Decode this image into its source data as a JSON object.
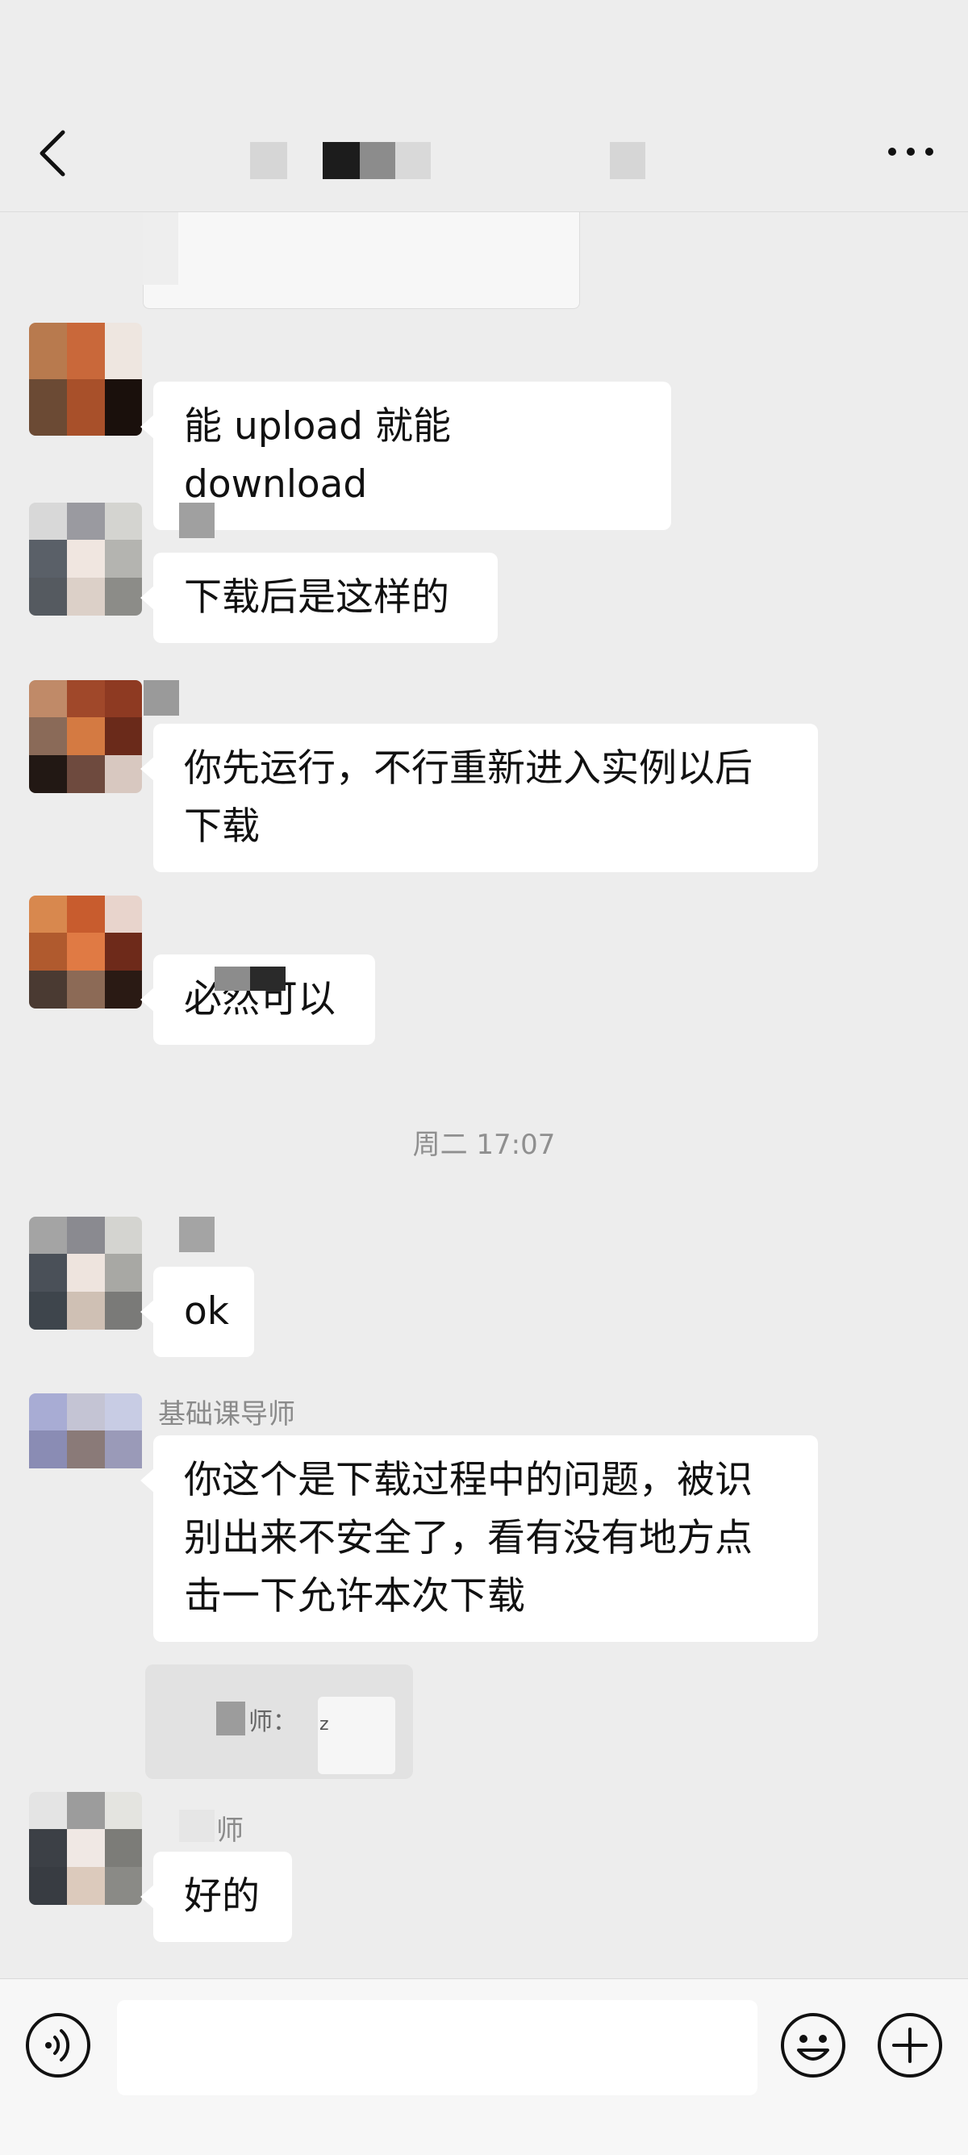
{
  "header": {
    "back_icon": "chevron-left-icon",
    "more_icon": "more-dots-icon"
  },
  "messages": [
    {
      "id": "m1",
      "text": "能 upload 就能 download"
    },
    {
      "id": "m2",
      "text": "下载后是这样的"
    },
    {
      "id": "m3",
      "text": "你先运行，不行重新进入实例以后下载"
    },
    {
      "id": "m4",
      "text": "必然可以"
    },
    {
      "id": "m5",
      "text": "ok"
    },
    {
      "id": "m6",
      "sender": "基础课导师",
      "text": "你这个是下载过程中的问题，被识别出来不安全了，看有没有地方点击一下允许本次下载"
    },
    {
      "id": "m7",
      "sender_fragment": "师",
      "text": "好的"
    }
  ],
  "timestamp": "周二 17:07",
  "quote": {
    "text": "师：",
    "suffix": "z"
  },
  "input_bar": {
    "voice_icon": "voice-icon",
    "emoji_icon": "emoji-icon",
    "plus_icon": "plus-icon",
    "placeholder": ""
  }
}
